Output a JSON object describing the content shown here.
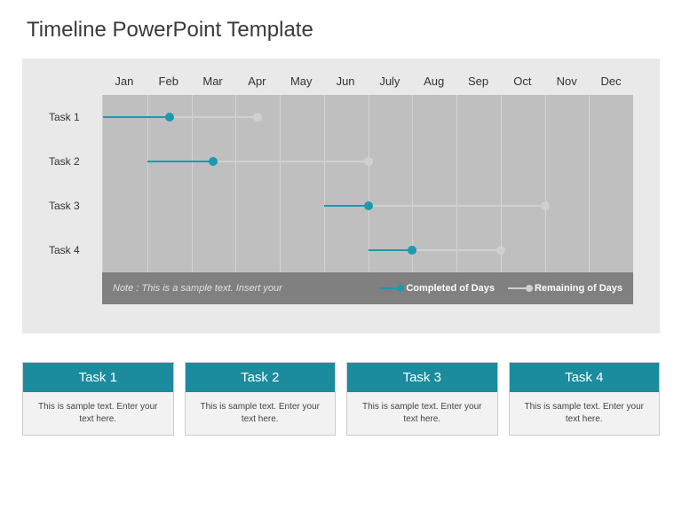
{
  "title": "Timeline PowerPoint Template",
  "chart_data": {
    "type": "bar",
    "months": [
      "Jan",
      "Feb",
      "Mar",
      "Apr",
      "May",
      "Jun",
      "July",
      "Aug",
      "Sep",
      "Oct",
      "Nov",
      "Dec"
    ],
    "xlabel": "",
    "ylabel": "",
    "series": [
      {
        "name": "Completed of Days"
      },
      {
        "name": "Remaining of Days"
      }
    ],
    "tasks": [
      {
        "name": "Task 1",
        "completed_start": 0,
        "completed_end": 1.5,
        "remaining_start": 1.5,
        "remaining_end": 3.5
      },
      {
        "name": "Task 2",
        "completed_start": 1,
        "completed_end": 2.5,
        "remaining_start": 2.5,
        "remaining_end": 6
      },
      {
        "name": "Task 3",
        "completed_start": 5,
        "completed_end": 6,
        "remaining_start": 6,
        "remaining_end": 10
      },
      {
        "name": "Task 4",
        "completed_start": 6,
        "completed_end": 7,
        "remaining_start": 7,
        "remaining_end": 9
      }
    ]
  },
  "legend": {
    "note": "Note : This is a sample text. Insert your",
    "completed": "Completed of Days",
    "remaining": "Remaining of Days"
  },
  "cards": [
    {
      "title": "Task 1",
      "body": "This is sample text. Enter your text here."
    },
    {
      "title": "Task 2",
      "body": "This is sample text. Enter your text here."
    },
    {
      "title": "Task 3",
      "body": "This is sample text. Enter your text here."
    },
    {
      "title": "Task 4",
      "body": "This is sample text. Enter your text here."
    }
  ],
  "colors": {
    "completed": "#1b9ab0",
    "remaining": "#d0d0d0",
    "card_header": "#1b8b9e"
  }
}
